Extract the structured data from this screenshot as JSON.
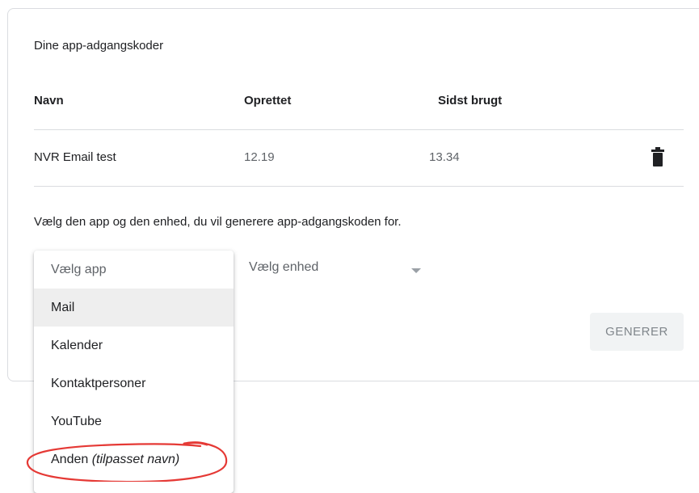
{
  "section_title": "Dine app-adgangskoder",
  "table": {
    "headers": [
      "Navn",
      "Oprettet",
      "Sidst brugt"
    ],
    "rows": [
      {
        "name": "NVR Email test",
        "created": "12.19",
        "last_used": "13.34",
        "action_icon": "trash-icon"
      }
    ]
  },
  "instruction": "Vælg den app og den enhed, du vil generere app-adgangskoden for.",
  "app_select": {
    "placeholder": "Vælg app",
    "options": [
      {
        "label": "Mail"
      },
      {
        "label": "Kalender"
      },
      {
        "label": "Kontaktpersoner"
      },
      {
        "label": "YouTube"
      },
      {
        "label": "Anden",
        "suffix": "(tilpasset navn)"
      }
    ],
    "highlighted_index": 0
  },
  "device_select": {
    "placeholder": "Vælg enhed"
  },
  "generate_button": {
    "label": "GENERER"
  },
  "colors": {
    "annotation": "#e53935",
    "divider": "#dadce0",
    "highlight": "#eeeeee"
  }
}
